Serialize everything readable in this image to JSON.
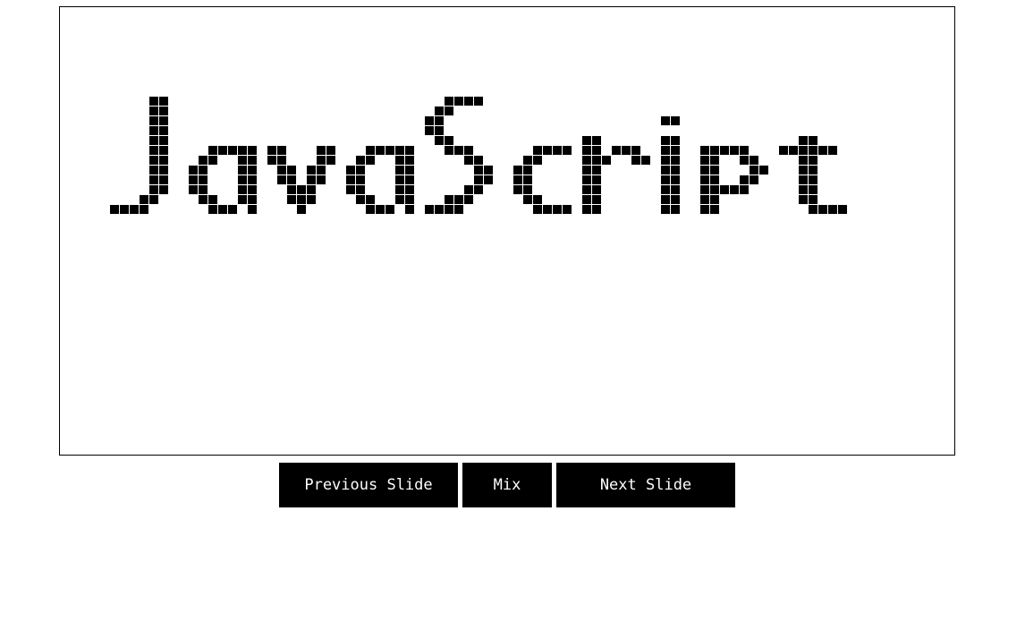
{
  "slide": {
    "text": "JavaScript"
  },
  "controls": {
    "previous_label": "Previous Slide",
    "mix_label": "Mix",
    "next_label": "Next Slide"
  }
}
